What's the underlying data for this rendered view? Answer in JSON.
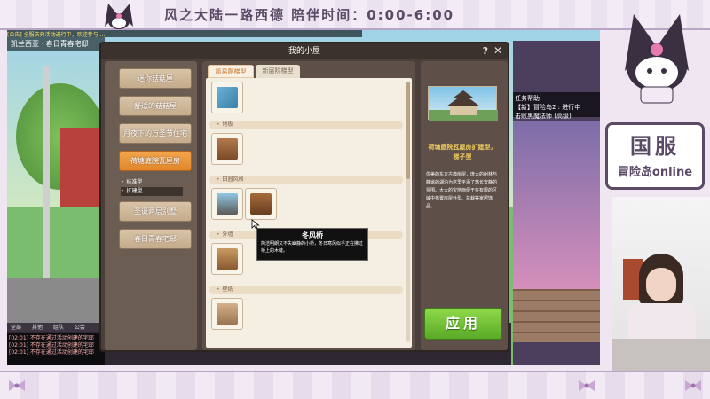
{
  "overlay": {
    "banner_title": "风之大陆一路西德  陪伴时间：0:00-6:00",
    "sticker_title": "国服",
    "sticker_subtitle": "冒险岛online"
  },
  "game": {
    "location": "凯兰西亚 · 春日青春宅邸",
    "info_line": "[公告] 全服庆典活动进行中，欢迎参与 …",
    "right_menu": [
      "任务帮助",
      "【新】冒险岛2 : 进行中",
      "击败黑魔法师 (高级)"
    ],
    "chat_tabs": [
      "全部",
      "其他",
      "组队",
      "公会"
    ],
    "chat_lines": [
      "[02:01] 不存在通过活动创建的宅邸",
      "[02:01] 不存在通过活动创建的宅邸",
      "[02:01] 不存在通过活动创建的宅邸"
    ]
  },
  "dialog": {
    "title": "我的小屋",
    "help": "?",
    "close": "✕",
    "houses": [
      {
        "label": "迷你菇菇屋",
        "active": false
      },
      {
        "label": "舒适的菇菇屋",
        "active": false
      },
      {
        "label": "月夜下的万圣节住宅",
        "active": false
      },
      {
        "label": "荷塘庭院瓦屋房",
        "active": true
      }
    ],
    "subitems": [
      {
        "label": "标准型",
        "selected": false
      },
      {
        "label": "扩建型",
        "selected": true
      }
    ],
    "houses_after": [
      {
        "label": "圣诞两层别墅"
      },
      {
        "label": "春日青春宅邸"
      }
    ],
    "tabs": [
      "简易爬梯型",
      "新层阶梯型"
    ],
    "categories": [
      "地板",
      "田园风格",
      "外墙",
      "壁纸"
    ],
    "tooltip": {
      "title": "冬风桥",
      "desc": "简洁明朗又不失幽静的小桥，冬日寒风似乎正在拂过桥上的木缝。"
    },
    "preview": {
      "name": "荷塘庭院瓦屋房扩建型，梯子型",
      "desc": "优美的东方古典房屋，庞大的树林与静谧的湖泊为这里平添了悠长安静的氛围。大大的宝地面便于在有限的区域中布置房屋外型、盆栽等家居饰品。"
    },
    "apply_label": "应用"
  },
  "colors": {
    "accent_orange": "#e2862a",
    "apply_green": "#5aaa26",
    "panel_bg": "#f5efe3",
    "frame_purple": "#5a4a66"
  }
}
